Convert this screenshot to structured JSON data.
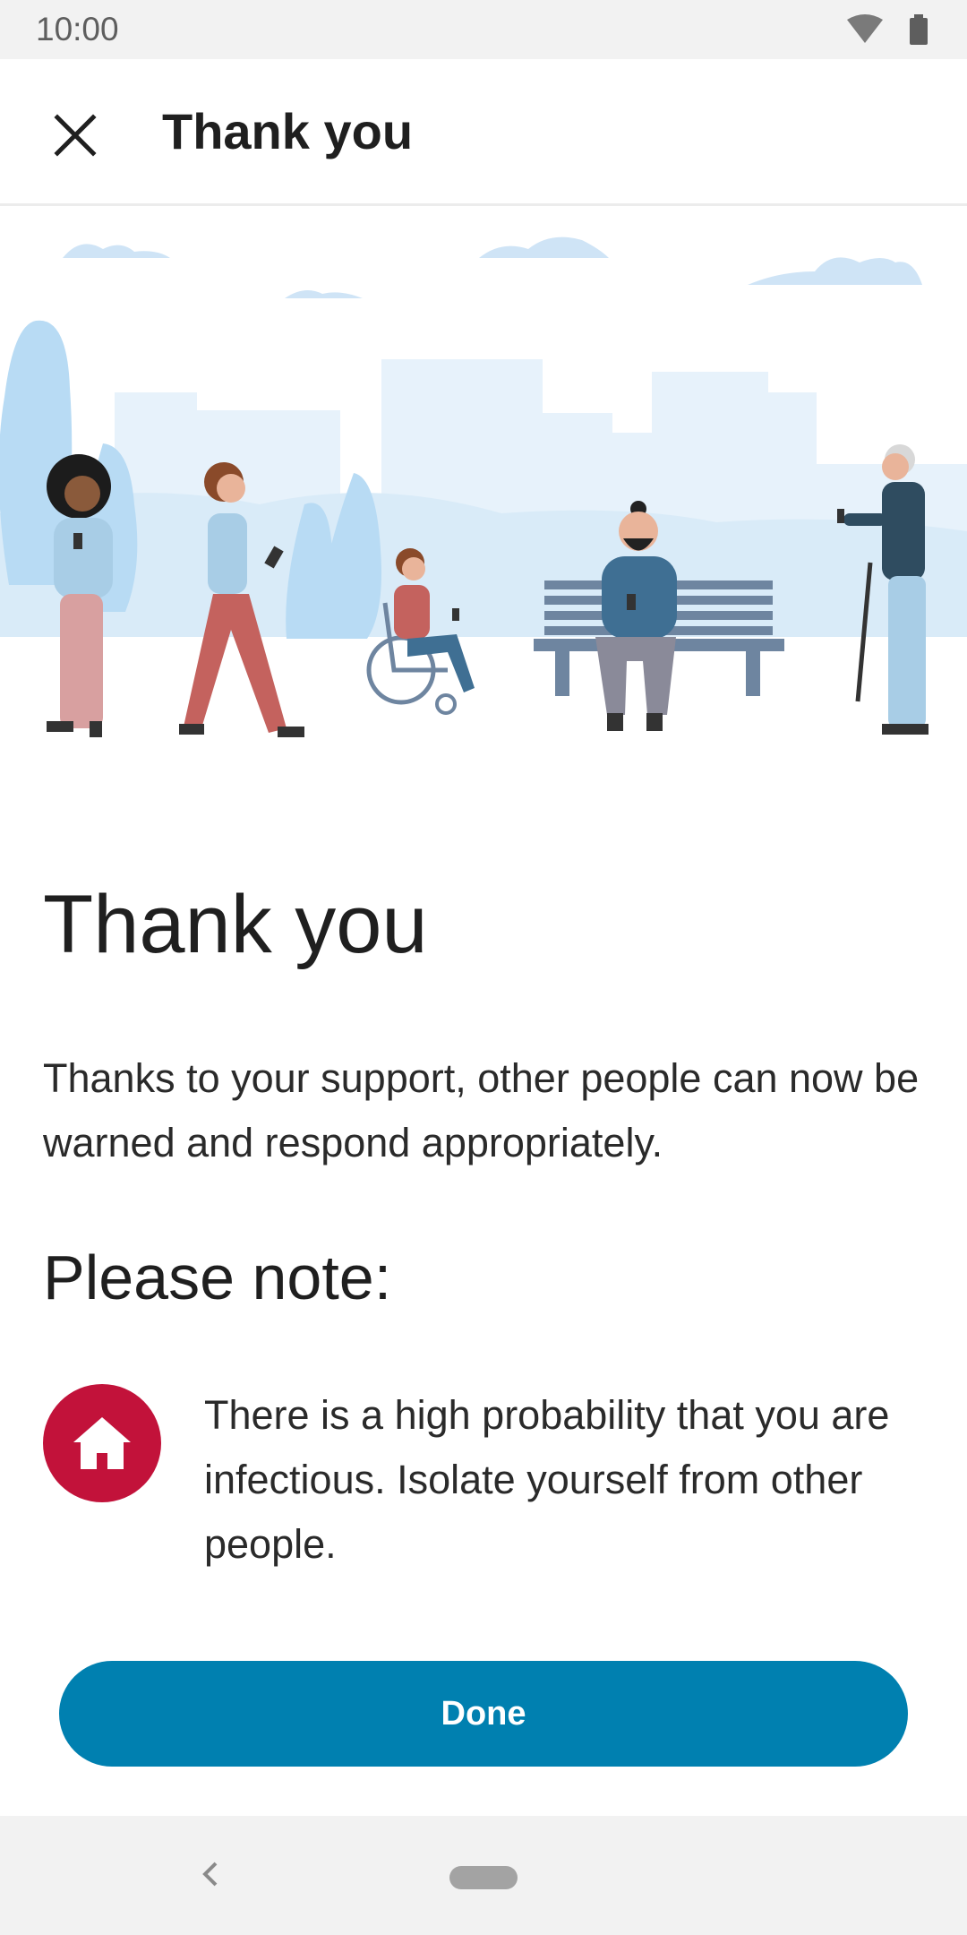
{
  "status_bar": {
    "time": "10:00",
    "icons": [
      "wifi-icon",
      "battery-icon"
    ]
  },
  "app_bar": {
    "title": "Thank you",
    "close_icon": "close-icon"
  },
  "content": {
    "headline": "Thank you",
    "intro": "Thanks to your support, other people can now be warned and respond appropriately.",
    "note_heading": "Please note:",
    "note_icon": "home-icon",
    "note_text": "There is a high probability that you are infectious. Isolate yourself from other people."
  },
  "actions": {
    "done_label": "Done"
  },
  "nav_bar": {
    "icons": [
      "back-icon",
      "home-pill"
    ]
  },
  "colors": {
    "accent": "#0080b0",
    "alert_red": "#c2123a",
    "illustration_blue": "#bcdcf3"
  }
}
